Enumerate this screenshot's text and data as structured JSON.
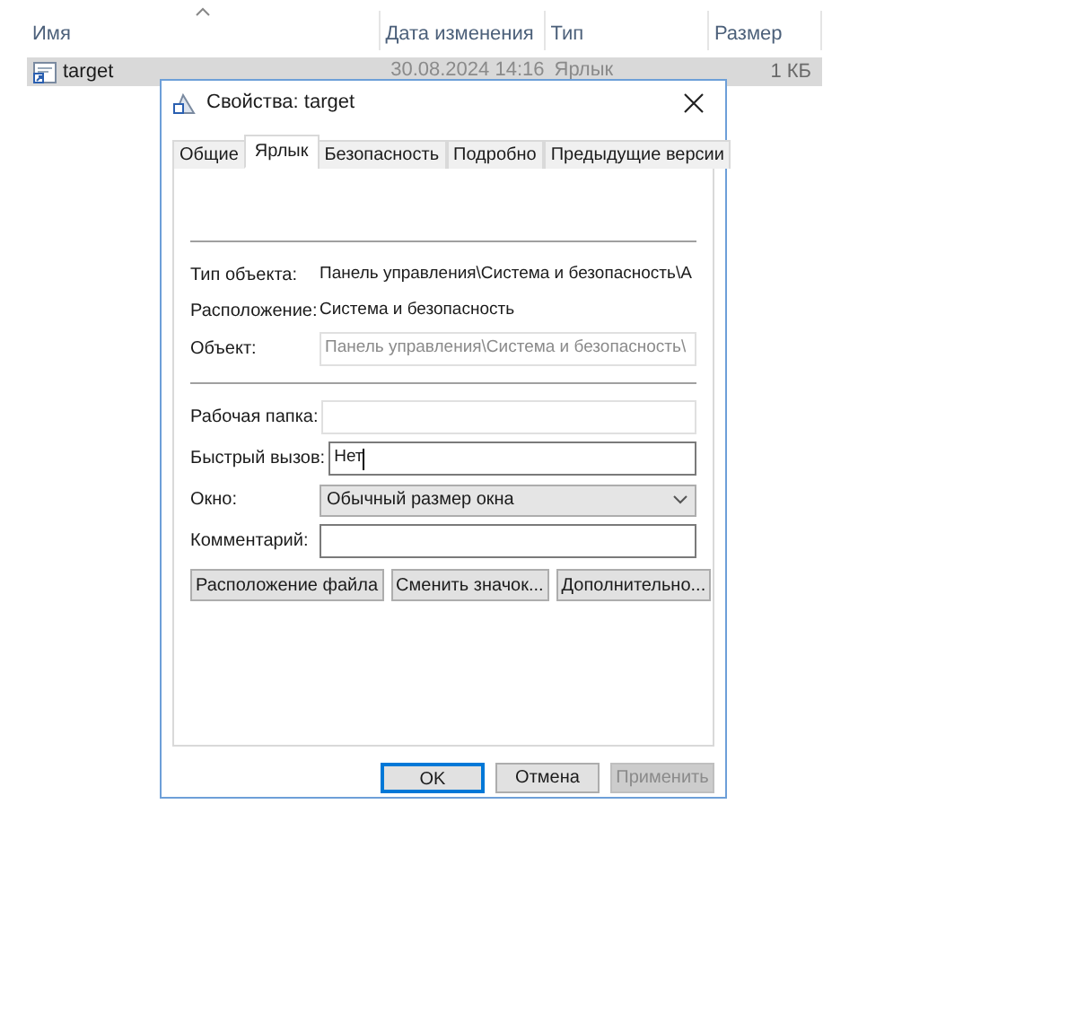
{
  "explorer": {
    "columns": [
      {
        "label": "Имя",
        "sorted": true
      },
      {
        "label": "Дата изменения",
        "sorted": false
      },
      {
        "label": "Тип",
        "sorted": false
      },
      {
        "label": "Размер",
        "sorted": false
      }
    ],
    "rows": [
      {
        "name": "target",
        "date": "30.08.2024 14:16",
        "type": "Ярлык",
        "size": "1 КБ",
        "selected": true
      }
    ]
  },
  "dialog": {
    "title": "Свойства: target",
    "tabs": [
      {
        "label": "Общие",
        "selected": false
      },
      {
        "label": "Ярлык",
        "selected": true
      },
      {
        "label": "Безопасность",
        "selected": false
      },
      {
        "label": "Подробно",
        "selected": false
      },
      {
        "label": "Предыдущие версии",
        "selected": false
      }
    ],
    "info": [
      {
        "label": "Тип объекта:",
        "value": "Панель управления\\Система и безопасность\\А"
      },
      {
        "label": "Расположение:",
        "value": "Система и безопасность"
      }
    ],
    "target_field": {
      "label": "Объект:",
      "value": "Панель управления\\Система и безопасность\\",
      "disabled": true
    },
    "fields": [
      {
        "kind": "text",
        "label": "Рабочая папка:",
        "disabled": true
      },
      {
        "kind": "text",
        "label": "Быстрый вызов:",
        "value": "Нет",
        "disabled": false,
        "focused": true
      },
      {
        "kind": "dropdown",
        "label": "Окно:",
        "value": "Обычный размер окна",
        "disabled": false
      },
      {
        "kind": "text",
        "label": "Комментарий:",
        "disabled": false
      }
    ],
    "actions": [
      "Расположение файла",
      "Сменить значок...",
      "Дополнительно..."
    ],
    "buttons": [
      {
        "label": "OK",
        "default": true,
        "disabled": false
      },
      {
        "label": "Отмена",
        "default": false,
        "disabled": false
      },
      {
        "label": "Применить",
        "default": false,
        "disabled": true
      }
    ]
  }
}
